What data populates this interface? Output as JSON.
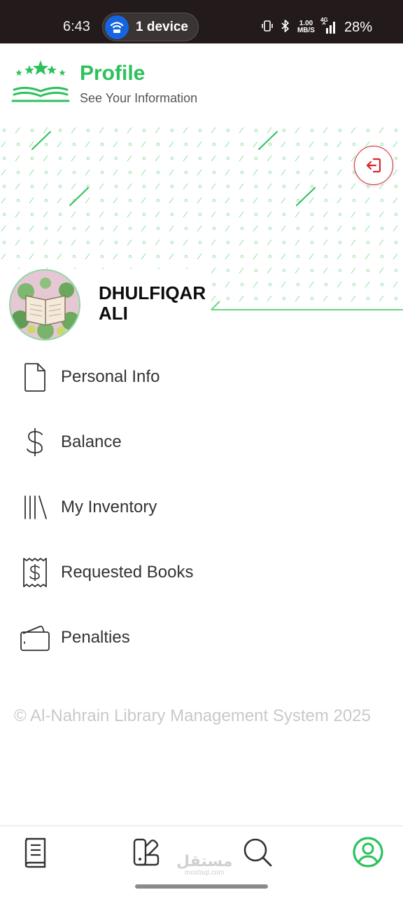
{
  "status_bar": {
    "time": "6:43",
    "device_pill_label": "1 device",
    "net_speed_value": "1.00",
    "net_speed_unit": "MB/S",
    "network": "4G",
    "battery": "28%"
  },
  "header": {
    "title": "Profile",
    "subtitle": "See Your Information"
  },
  "user": {
    "name": "DHULFIQAR ALI"
  },
  "menu": [
    {
      "label": "Personal Info",
      "icon": "document-icon"
    },
    {
      "label": "Balance",
      "icon": "dollar-icon"
    },
    {
      "label": "My Inventory",
      "icon": "library-icon"
    },
    {
      "label": "Requested Books",
      "icon": "receipt-icon"
    },
    {
      "label": "Penalties",
      "icon": "wallet-icon"
    }
  ],
  "footer": {
    "copyright": "©  Al-Nahrain Library Management System 2025"
  },
  "bottom_nav": [
    {
      "id": "books",
      "icon": "book-icon",
      "active": false
    },
    {
      "id": "catalog",
      "icon": "swatchbook-icon",
      "active": false
    },
    {
      "id": "search",
      "icon": "search-icon",
      "active": false
    },
    {
      "id": "profile",
      "icon": "user-circle-icon",
      "active": true
    }
  ],
  "watermark": {
    "arabic": "مستقل",
    "latin": "mostaql.com"
  },
  "colors": {
    "accent": "#2cc15a",
    "danger": "#d9252b",
    "status_bar": "#231b1b",
    "text": "#333333",
    "muted": "#c9c9c9"
  }
}
